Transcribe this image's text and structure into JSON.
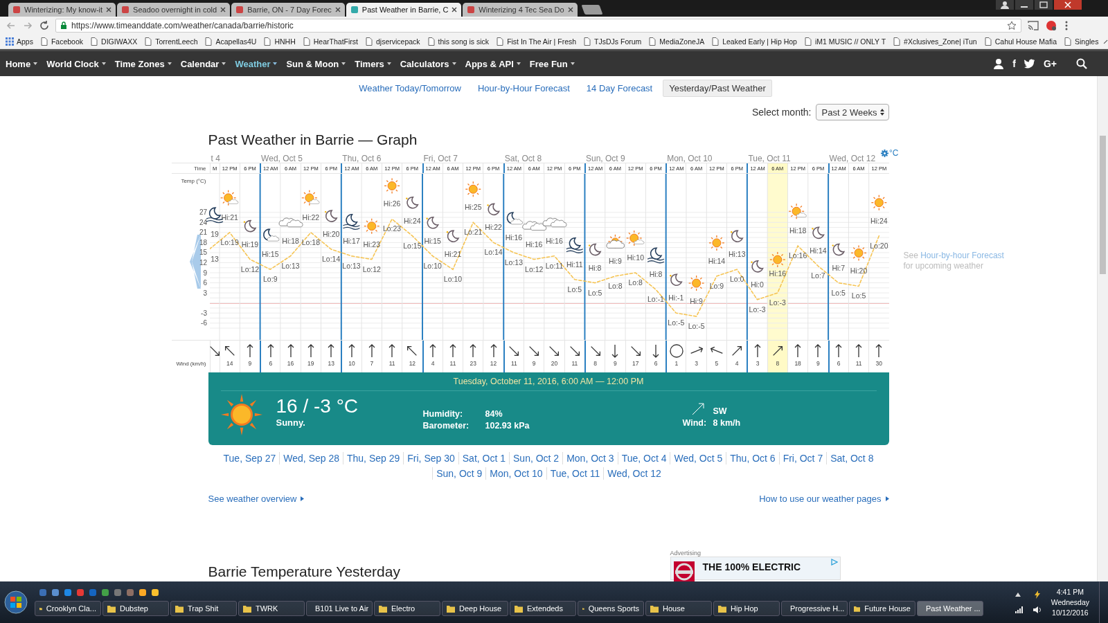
{
  "browser": {
    "tabs": [
      {
        "title": "Winterizing: My know-it",
        "selected": false
      },
      {
        "title": "Seadoo overnight in cold",
        "selected": false
      },
      {
        "title": "Barrie, ON - 7 Day Forec",
        "selected": false
      },
      {
        "title": "Past Weather in Barrie, C",
        "selected": true
      },
      {
        "title": "Winterizing 4 Tec Sea Do",
        "selected": false
      }
    ],
    "url": "https://www.timeanddate.com/weather/canada/barrie/historic",
    "bookmarks": [
      "Apps",
      "Facebook",
      "DIGIWAXX",
      "TorrentLeech",
      "Acapellas4U",
      "HNHH",
      "HearThatFirst",
      "djservicepack",
      "this song is sick",
      "Fist In The Air | Fresh",
      "TJsDJs Forum",
      "MediaZoneJA",
      "Leaked Early | Hip Hop",
      "iM1 MUSIC // ONLY T",
      "#Xclusives_Zone| iTun",
      "Cahul House Mafia",
      "Singles"
    ]
  },
  "site_nav": {
    "items": [
      {
        "label": "Home",
        "selected": false
      },
      {
        "label": "World Clock",
        "selected": false
      },
      {
        "label": "Time Zones",
        "selected": false
      },
      {
        "label": "Calendar",
        "selected": false
      },
      {
        "label": "Weather",
        "selected": true
      },
      {
        "label": "Sun & Moon",
        "selected": false
      },
      {
        "label": "Timers",
        "selected": false
      },
      {
        "label": "Calculators",
        "selected": false
      },
      {
        "label": "Apps & API",
        "selected": false
      },
      {
        "label": "Free Fun",
        "selected": false
      }
    ],
    "facebook_glyph": "f",
    "gplus_glyph": "G+"
  },
  "subnav": [
    {
      "label": "Weather Today/Tomorrow",
      "selected": false
    },
    {
      "label": "Hour-by-Hour Forecast",
      "selected": false
    },
    {
      "label": "14 Day Forecast",
      "selected": false
    },
    {
      "label": "Yesterday/Past Weather",
      "selected": true
    }
  ],
  "month_select": {
    "label": "Select month:",
    "value": "Past 2 Weeks"
  },
  "heading": "Past Weather in Barrie — Graph",
  "graph": {
    "unit": "°C",
    "time_label": "Time",
    "wind_label": "Wind (km/h)",
    "times": [
      "M",
      "12 PM",
      "6 PM",
      "12 AM",
      "6 AM",
      "12 PM",
      "6 PM",
      "12 AM",
      "6 AM",
      "12 PM",
      "6 PM",
      "12 AM",
      "6 AM",
      "12 PM",
      "6 PM",
      "12 AM",
      "6 AM",
      "12 PM",
      "6 PM",
      "12 AM",
      "6 AM",
      "12 PM",
      "6 PM",
      "12 AM",
      "6 AM",
      "12 PM",
      "6 PM",
      "12 AM",
      "6 AM",
      "12 PM",
      "6 PM",
      "12 AM",
      "6 AM",
      "12 PM"
    ],
    "side_note": {
      "before": "See",
      "link": "Hour-by-hour Forecast",
      "after": "for upcoming weather"
    },
    "days": [
      {
        "label": "t 4",
        "columns": [
          {
            "kind": "moon-fog",
            "hi": "19",
            "lo": "13",
            "wind": {
              "kind": "se"
            },
            "selected": false
          },
          {
            "kind": "sun-cloud",
            "hi": "Hi:21",
            "lo": "Lo:19",
            "wind": {
              "kind": "nw",
              "speed": "14"
            },
            "selected": false
          },
          {
            "kind": "moon",
            "hi": "Hi:19",
            "lo": "Lo:12",
            "wind": {
              "kind": "n",
              "speed": "9"
            },
            "selected": false
          }
        ]
      },
      {
        "label": "Wed, Oct 5",
        "columns": [
          {
            "kind": "moon-cloud",
            "hi": "Hi:15",
            "lo": "Lo:9",
            "wind": {
              "kind": "n",
              "speed": "6"
            },
            "selected": false
          },
          {
            "kind": "cloud",
            "hi": "Hi:18",
            "lo": "Lo:13",
            "wind": {
              "kind": "n",
              "speed": "16"
            },
            "selected": false
          },
          {
            "kind": "sun-cloud",
            "hi": "Hi:22",
            "lo": "Lo:18",
            "wind": {
              "kind": "n",
              "speed": "19"
            },
            "selected": false
          },
          {
            "kind": "moon",
            "hi": "Hi:20",
            "lo": "Lo:14",
            "wind": {
              "kind": "n",
              "speed": "13"
            },
            "selected": false
          }
        ]
      },
      {
        "label": "Thu, Oct 6",
        "columns": [
          {
            "kind": "moon-fog",
            "hi": "Hi:17",
            "lo": "Lo:13",
            "wind": {
              "kind": "n",
              "speed": "10"
            },
            "selected": false
          },
          {
            "kind": "sun",
            "hi": "Hi:23",
            "lo": "Lo:12",
            "wind": {
              "kind": "n",
              "speed": "7"
            },
            "selected": false
          },
          {
            "kind": "sun",
            "hi": "Hi:26",
            "lo": "Lo:23",
            "wind": {
              "kind": "n",
              "speed": "11"
            },
            "selected": false
          },
          {
            "kind": "moon",
            "hi": "Hi:24",
            "lo": "Lo:15",
            "wind": {
              "kind": "nw",
              "speed": "12"
            },
            "selected": false
          }
        ]
      },
      {
        "label": "Fri, Oct 7",
        "columns": [
          {
            "kind": "moon",
            "hi": "Hi:15",
            "lo": "Lo:10",
            "wind": {
              "kind": "n",
              "speed": "4"
            },
            "selected": false
          },
          {
            "kind": "moon",
            "hi": "Hi:21",
            "lo": "Lo:10",
            "wind": {
              "kind": "n",
              "speed": "11"
            },
            "selected": false
          },
          {
            "kind": "sun",
            "hi": "Hi:25",
            "lo": "Lo:21",
            "wind": {
              "kind": "n",
              "speed": "23"
            },
            "selected": false
          },
          {
            "kind": "moon",
            "hi": "Hi:22",
            "lo": "Lo:14",
            "wind": {
              "kind": "n",
              "speed": "12"
            },
            "selected": false
          }
        ]
      },
      {
        "label": "Sat, Oct 8",
        "columns": [
          {
            "kind": "moon-cloud",
            "hi": "Hi:16",
            "lo": "Lo:13",
            "wind": {
              "kind": "se",
              "speed": "11"
            },
            "selected": false
          },
          {
            "kind": "cloud",
            "hi": "Hi:16",
            "lo": "Lo:12",
            "wind": {
              "kind": "se",
              "speed": "9"
            },
            "selected": false
          },
          {
            "kind": "cloud",
            "hi": "Hi:16",
            "lo": "Lo:11",
            "wind": {
              "kind": "se",
              "speed": "20"
            },
            "selected": false
          },
          {
            "kind": "moon-fog",
            "hi": "Hi:11",
            "lo": "Lo:5",
            "wind": {
              "kind": "se",
              "speed": "11"
            },
            "selected": false
          }
        ]
      },
      {
        "label": "Sun, Oct 9",
        "columns": [
          {
            "kind": "moon",
            "hi": "Hi:8",
            "lo": "Lo:5",
            "wind": {
              "kind": "se",
              "speed": "8"
            },
            "selected": false
          },
          {
            "kind": "cloud-sun",
            "hi": "Hi:9",
            "lo": "Lo:8",
            "wind": {
              "kind": "s",
              "speed": "9"
            },
            "selected": false
          },
          {
            "kind": "sun-cloud",
            "hi": "Hi:10",
            "lo": "Lo:8",
            "wind": {
              "kind": "se",
              "speed": "17"
            },
            "selected": false
          },
          {
            "kind": "moon-fog",
            "hi": "Hi:8",
            "lo": "Lo:-1",
            "wind": {
              "kind": "s",
              "speed": "6"
            },
            "selected": false
          }
        ]
      },
      {
        "label": "Mon, Oct 10",
        "columns": [
          {
            "kind": "moon",
            "hi": "Hi:-1",
            "lo": "Lo:-5",
            "wind": {
              "kind": "calm",
              "speed": "1"
            },
            "selected": false
          },
          {
            "kind": "sun",
            "hi": "Hi:9",
            "lo": "Lo:-5",
            "wind": {
              "kind": "ene",
              "speed": "3"
            },
            "selected": false
          },
          {
            "kind": "sun",
            "hi": "Hi:14",
            "lo": "Lo:9",
            "wind": {
              "kind": "wnw",
              "speed": "5"
            },
            "selected": false
          },
          {
            "kind": "moon",
            "hi": "Hi:13",
            "lo": "Lo:0",
            "wind": {
              "kind": "ne",
              "speed": "4"
            },
            "selected": false
          }
        ]
      },
      {
        "label": "Tue, Oct 11",
        "columns": [
          {
            "kind": "moon",
            "hi": "Hi:0",
            "lo": "Lo:-3",
            "wind": {
              "kind": "n",
              "speed": "3"
            },
            "selected": false
          },
          {
            "kind": "sun",
            "hi": "Hi:16",
            "lo": "Lo:-3",
            "wind": {
              "kind": "ne",
              "speed": "8"
            },
            "selected": true
          },
          {
            "kind": "sun-cloud",
            "hi": "Hi:18",
            "lo": "Lo:16",
            "wind": {
              "kind": "n",
              "speed": "18"
            },
            "selected": false
          },
          {
            "kind": "moon",
            "hi": "Hi:14",
            "lo": "Lo:7",
            "wind": {
              "kind": "n",
              "speed": "9"
            },
            "selected": false
          }
        ]
      },
      {
        "label": "Wed, Oct 12",
        "columns": [
          {
            "kind": "moon",
            "hi": "Hi:7",
            "lo": "Lo:5",
            "wind": {
              "kind": "n",
              "speed": "6"
            },
            "selected": false
          },
          {
            "kind": "sun",
            "hi": "Hi:20",
            "lo": "Lo:5",
            "wind": {
              "kind": "n",
              "speed": "11"
            },
            "selected": false
          },
          {
            "kind": "sun",
            "hi": "Hi:24",
            "lo": "Lo:20",
            "wind": {
              "kind": "n",
              "speed": "30"
            },
            "selected": false
          }
        ]
      }
    ],
    "chart_data": {
      "type": "line",
      "ylabel": "Temp (°C)",
      "ylim": [
        -11,
        38.5
      ],
      "grid": true,
      "yticks": [
        27,
        24,
        21,
        18,
        15,
        12,
        9,
        6,
        3,
        -3,
        -6
      ],
      "series": [
        {
          "color": "#f6c453",
          "line_style": "dashed",
          "values": [
            16,
            21,
            13,
            10,
            14,
            21,
            16,
            14,
            13,
            25,
            20,
            14,
            10,
            24,
            18,
            15,
            13,
            14,
            7,
            6,
            8,
            9,
            4,
            -3,
            -4,
            8,
            10,
            1,
            3,
            17,
            11,
            6,
            5,
            20
          ]
        }
      ]
    }
  },
  "detail": {
    "date": "Tuesday, October 11, 2016, 6:00 AM — 12:00 PM",
    "temp": "16 / -3 °C",
    "desc": "Sunny.",
    "rows": [
      {
        "label": "Humidity:",
        "value": "84%"
      },
      {
        "label": "Barometer:",
        "value": "102.93 kPa"
      }
    ],
    "wind_dir": "SW",
    "wind_label": "Wind:",
    "wind_value": "8 km/h"
  },
  "date_links": [
    "Tue, Sep 27",
    "Wed, Sep 28",
    "Thu, Sep 29",
    "Fri, Sep 30",
    "Sat, Oct 1",
    "Sun, Oct 2",
    "Mon, Oct 3",
    "Tue, Oct 4",
    "Wed, Oct 5",
    "Thu, Oct 6",
    "Fri, Oct 7",
    "Sat, Oct 8",
    "Sun, Oct 9",
    "Mon, Oct 10",
    "Tue, Oct 11",
    "Wed, Oct 12"
  ],
  "footer_links": [
    "See weather overview",
    "How to use our weather pages"
  ],
  "next_heading": "Barrie Temperature Yesterday",
  "ad": {
    "label": "Advertising",
    "headline": "THE 100% ELECTRIC"
  },
  "taskbar": {
    "buttons": [
      {
        "label": "Crooklyn Cla...",
        "kind": "folder",
        "selected": false
      },
      {
        "label": "Dubstep",
        "kind": "folder",
        "selected": false
      },
      {
        "label": "Trap Shit",
        "kind": "folder",
        "selected": false
      },
      {
        "label": "TWRK",
        "kind": "folder",
        "selected": false
      },
      {
        "label": "B101 Live to Air",
        "kind": "folder",
        "selected": false
      },
      {
        "label": "Electro",
        "kind": "folder",
        "selected": false
      },
      {
        "label": "Deep House",
        "kind": "folder",
        "selected": false
      },
      {
        "label": "Extendeds",
        "kind": "folder",
        "selected": false
      },
      {
        "label": "Queens Sports",
        "kind": "folder",
        "selected": false
      },
      {
        "label": "House",
        "kind": "folder",
        "selected": false
      },
      {
        "label": "Hip Hop",
        "kind": "folder",
        "selected": false
      },
      {
        "label": "Progressive H...",
        "kind": "folder",
        "selected": false
      },
      {
        "label": "Future House",
        "kind": "folder",
        "selected": false
      },
      {
        "label": "Past Weather ...",
        "kind": "browser",
        "selected": true
      }
    ],
    "time": "4:41 PM",
    "day": "Wednesday",
    "date": "10/12/2016"
  }
}
